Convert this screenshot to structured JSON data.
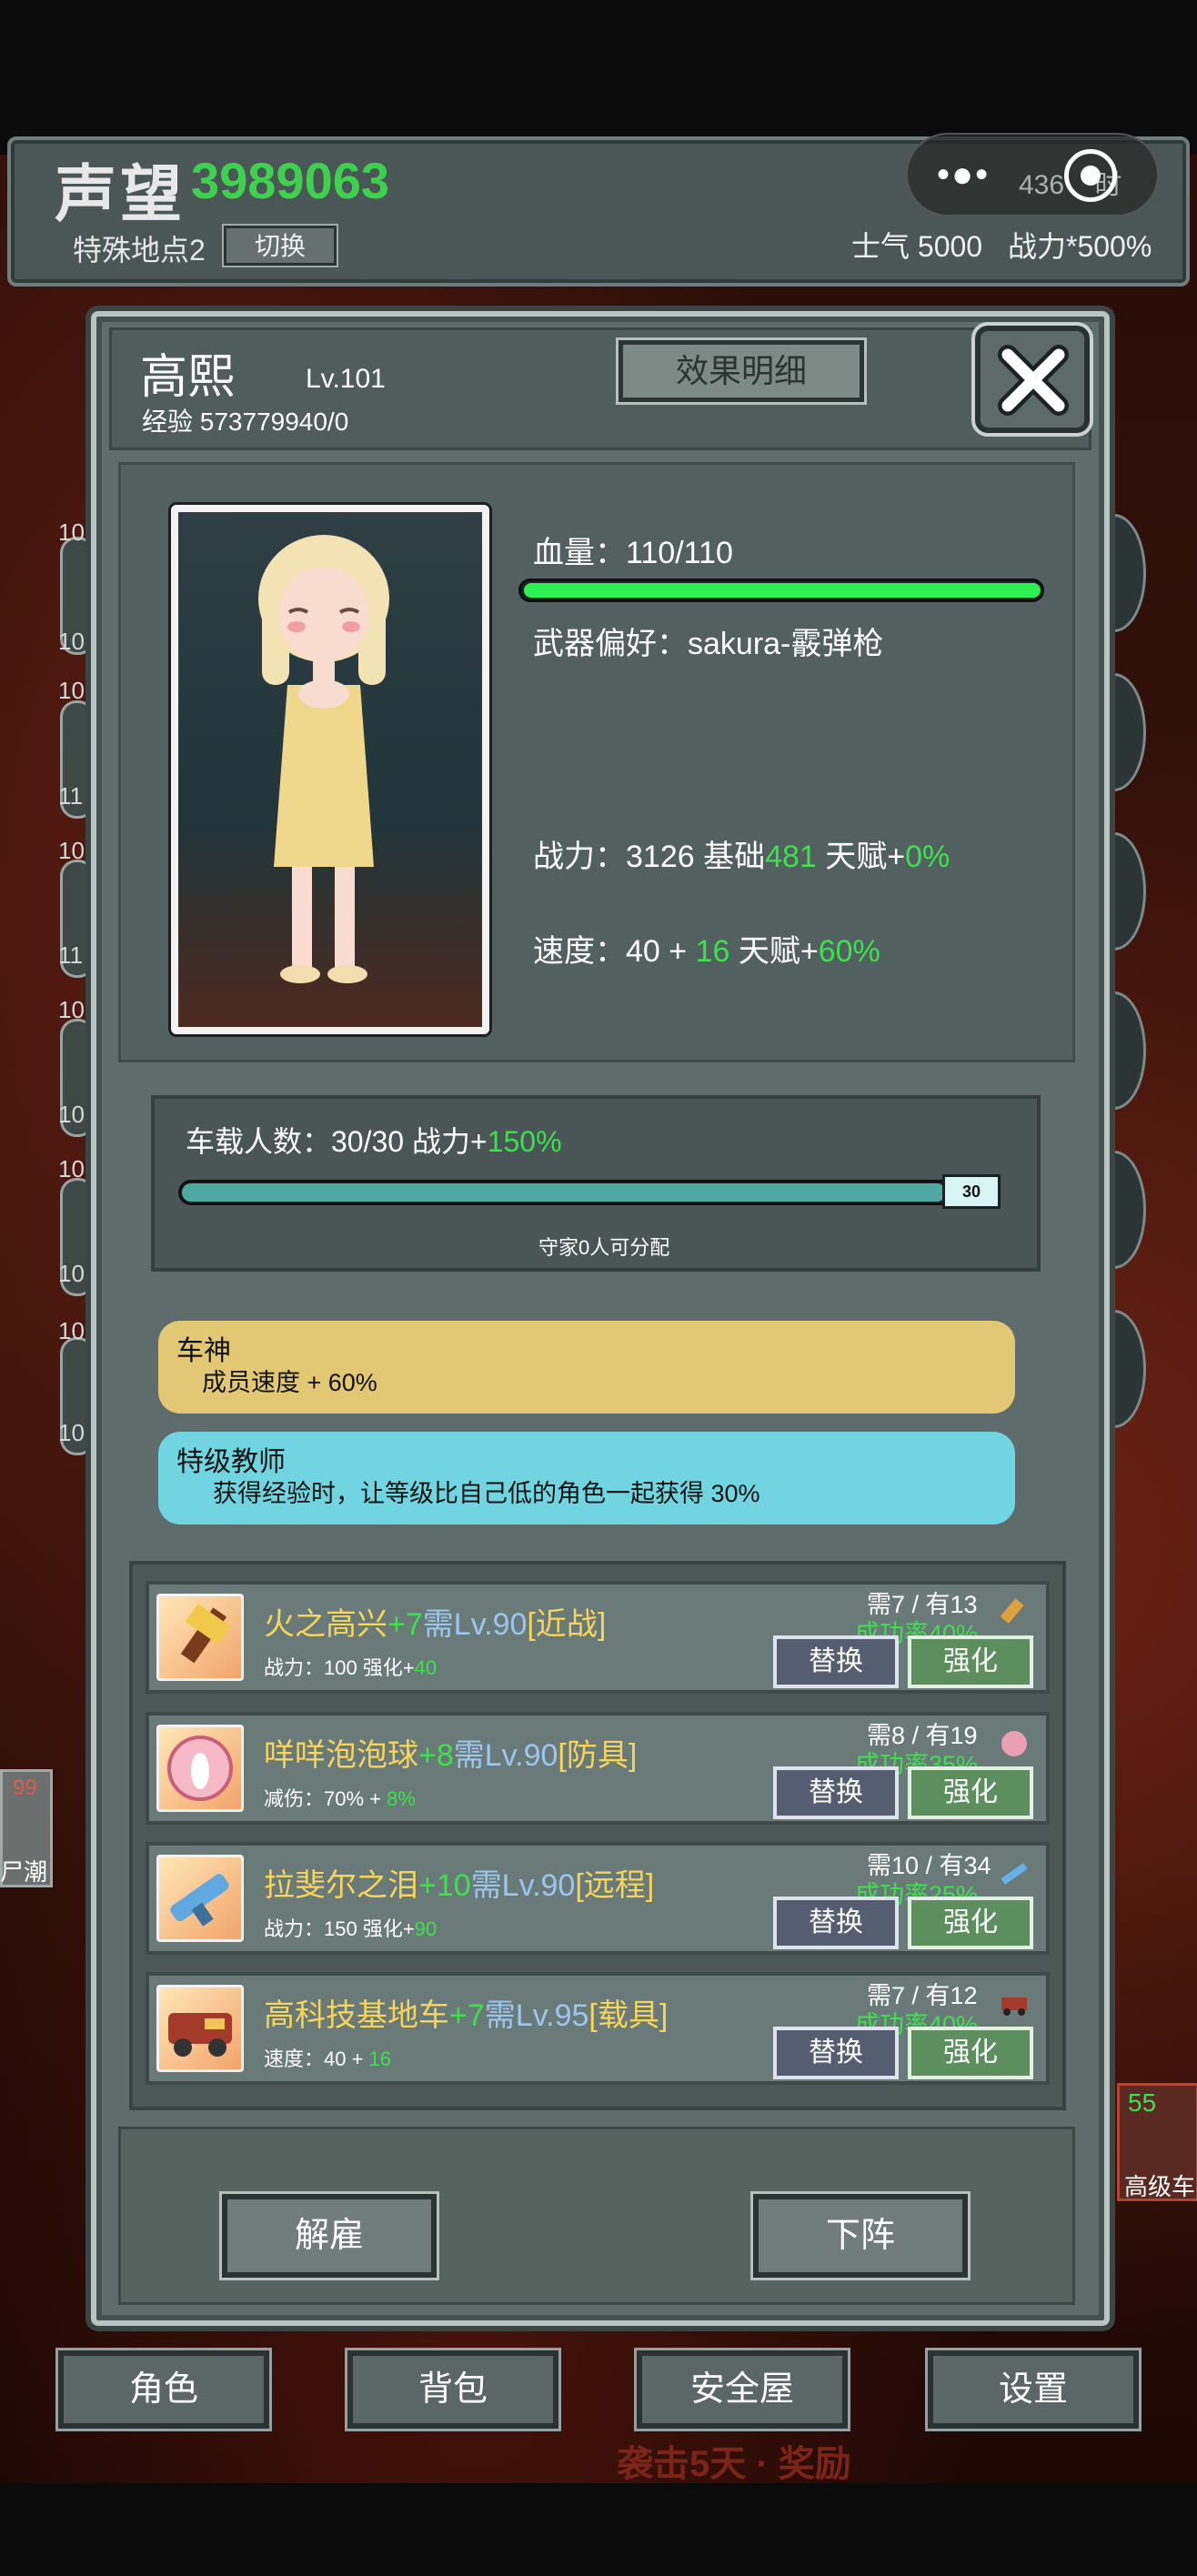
{
  "topbar": {
    "prestige_label": "声望",
    "prestige_value": "3989063",
    "location_label": "特殊地点2",
    "switch_label": "切换",
    "capsule_dots": "•●•",
    "capsule_text": "436",
    "capsule_suffix": "时",
    "morale": "士气 5000",
    "power_bonus": "战力*500%"
  },
  "hero": {
    "name": "高熙",
    "level": "Lv.101",
    "exp": "经验 573779940/0",
    "detail_button": "效果明细",
    "hp_label": "血量：110/110",
    "hp_fraction": 1.0,
    "weapon_pref": "武器偏好：sakura-霰弹枪",
    "power_prefix": "战力：3126 基础",
    "power_base": "481",
    "power_talent_label": " 天赋+",
    "power_talent": "0%",
    "speed_prefix": "速度：40 + ",
    "speed_bonus": "16",
    "speed_talent_label": " 天赋+",
    "speed_talent": "60%"
  },
  "car": {
    "label": "车载人数：30/30  战力+",
    "bonus": "150%",
    "count": "30",
    "fill_fraction": 1.0,
    "note": "守家0人可分配"
  },
  "skills": [
    {
      "title": "车神",
      "desc": "成员速度 + 60%"
    },
    {
      "title": "特级教师",
      "desc": "获得经验时，让等级比自己低的角色一起获得 30%"
    }
  ],
  "equipment": [
    {
      "name": "火之高兴",
      "plus": "+7",
      "need": "需Lv.90",
      "type": "[近战]",
      "stat_prefix": "战力：100 强化+",
      "stat_bonus": "40",
      "req": "需7 / 有13",
      "rate": "成功率40%",
      "replace": "替换",
      "upgrade": "强化",
      "icon": "hammer-icon"
    },
    {
      "name": "咩咩泡泡球",
      "plus": "+8",
      "need": "需Lv.90",
      "type": "[防具]",
      "stat_prefix": "减伤：70% + ",
      "stat_bonus": "8%",
      "req": "需8 / 有19",
      "rate": "成功率35%",
      "replace": "替换",
      "upgrade": "强化",
      "icon": "bubble-ball-icon"
    },
    {
      "name": "拉斐尔之泪",
      "plus": "+10",
      "need": "需Lv.90",
      "type": "[远程]",
      "stat_prefix": "战力：150 强化+",
      "stat_bonus": "90",
      "req": "需10 / 有34",
      "rate": "成功率25%",
      "replace": "替换",
      "upgrade": "强化",
      "icon": "blaster-icon"
    },
    {
      "name": "高科技基地车",
      "plus": "+7",
      "need": "需Lv.95",
      "type": "[载具]",
      "stat_prefix": "速度：40 + ",
      "stat_bonus": "16",
      "req": "需7 / 有12",
      "rate": "成功率40%",
      "replace": "替换",
      "upgrade": "强化",
      "icon": "base-vehicle-icon"
    }
  ],
  "actions": {
    "dismiss": "解雇",
    "remove": "下阵"
  },
  "tabs": [
    "角色",
    "背包",
    "安全屋",
    "设置"
  ],
  "raid_text": "袭击5天 · 奖励",
  "side": {
    "left_numbers": [
      "10",
      "10",
      "10",
      "10",
      "10",
      "10"
    ],
    "left_numbers_b": [
      "10",
      "11",
      "11",
      "10",
      "10",
      "10"
    ],
    "left_card_num": "99",
    "left_card_text": "尸潮",
    "right_card_num": "55",
    "right_card_text": "高级车"
  }
}
